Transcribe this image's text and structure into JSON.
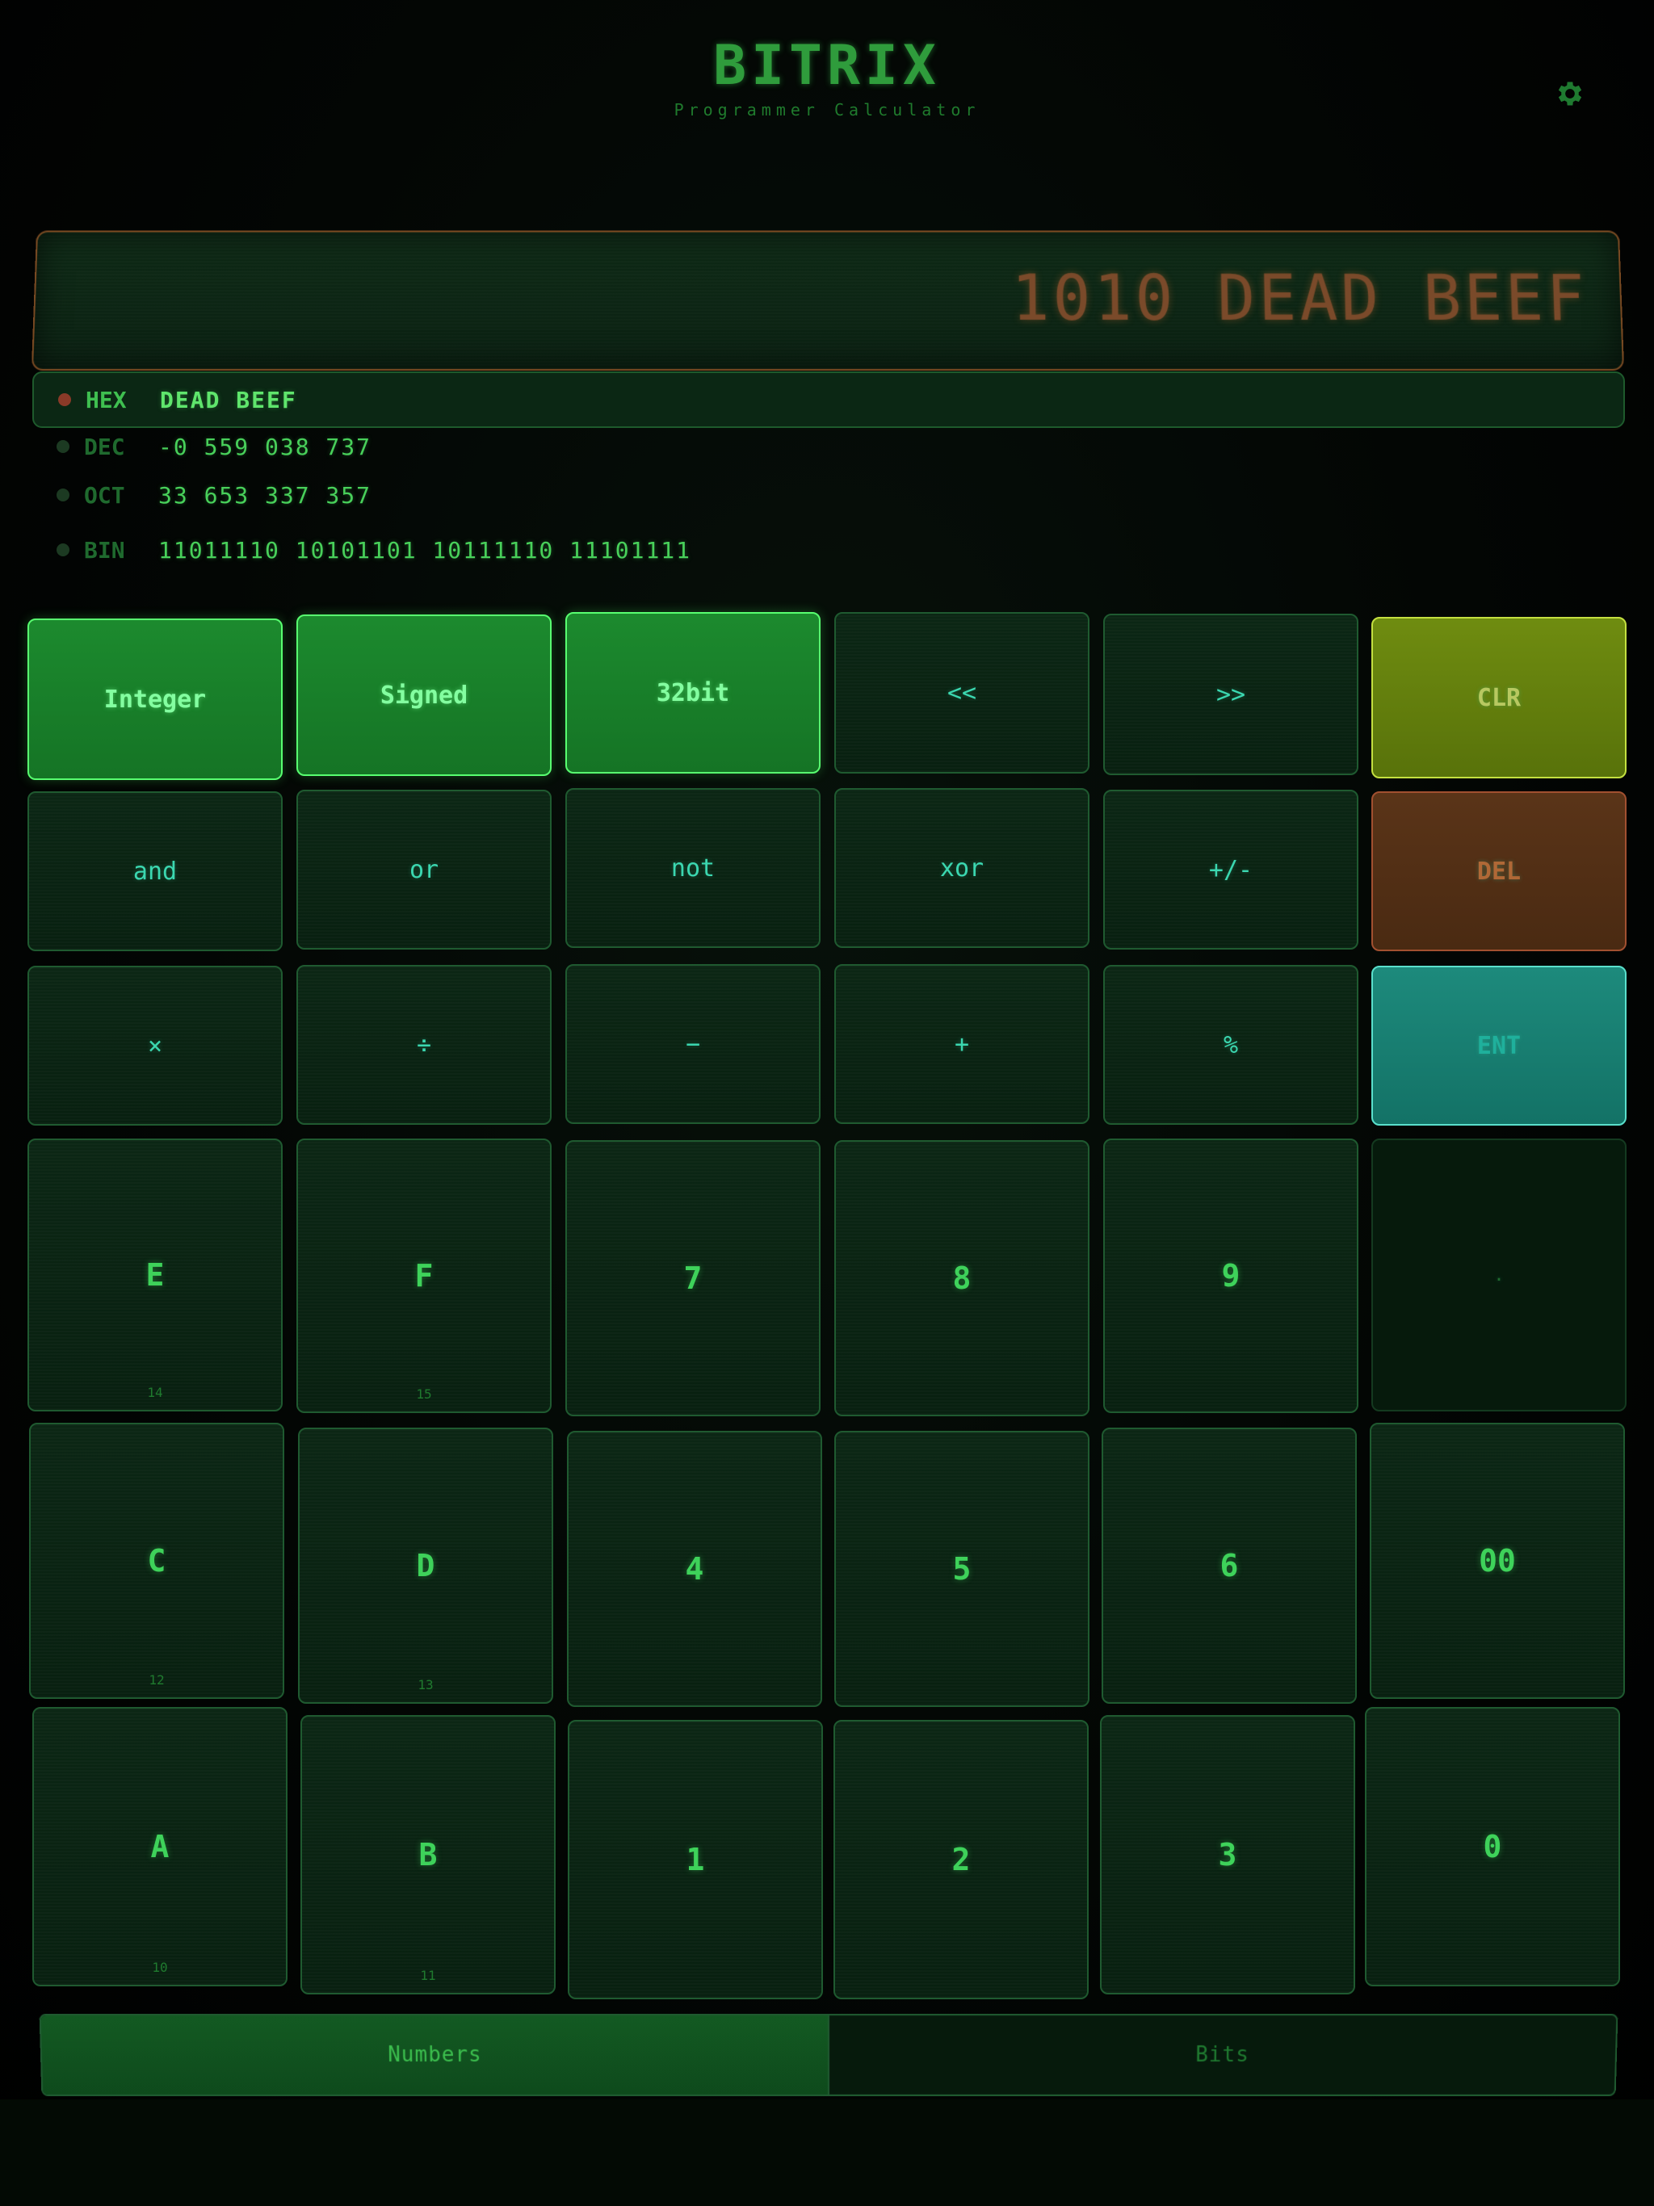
{
  "header": {
    "title": "BITRIX",
    "subtitle": "Programmer Calculator",
    "settings_icon": "gear-icon"
  },
  "display": {
    "main_value": "1010 DEAD BEEF"
  },
  "radix": [
    {
      "name": "HEX",
      "value": "DEAD BEEF",
      "active": true
    },
    {
      "name": "DEC",
      "value": "-0 559 038 737",
      "active": false
    },
    {
      "name": "OCT",
      "value": "33 653 337 357",
      "active": false
    },
    {
      "name": "BIN",
      "value": "11011110 10101101 10111110 11101111",
      "active": false
    }
  ],
  "keys": {
    "row1": [
      "Integer",
      "Signed",
      "32bit",
      "<<",
      ">>",
      "CLR"
    ],
    "row2": [
      "and",
      "or",
      "not",
      "xor",
      "+/-",
      "DEL"
    ],
    "row3": [
      "×",
      "÷",
      "−",
      "+",
      "%",
      "ENT"
    ],
    "row4": [
      {
        "label": "E",
        "sub": "14"
      },
      {
        "label": "F",
        "sub": "15"
      },
      {
        "label": "7"
      },
      {
        "label": "8"
      },
      {
        "label": "9"
      },
      {
        "label": "."
      }
    ],
    "row5": [
      {
        "label": "C",
        "sub": "12"
      },
      {
        "label": "D",
        "sub": "13"
      },
      {
        "label": "4"
      },
      {
        "label": "5"
      },
      {
        "label": "6"
      },
      {
        "label": "00"
      }
    ],
    "row6": [
      {
        "label": "A",
        "sub": "10"
      },
      {
        "label": "B",
        "sub": "11"
      },
      {
        "label": "1"
      },
      {
        "label": "2"
      },
      {
        "label": "3"
      },
      {
        "label": "0"
      }
    ]
  },
  "tabs": [
    {
      "label": "Numbers",
      "active": true
    },
    {
      "label": "Bits",
      "active": false
    }
  ],
  "colors": {
    "accent": "#3ed25a",
    "mode_key": "#1c8a2e",
    "clear_key": "#6f8c10",
    "delete_key": "#5a3418",
    "enter_key": "#1d8a7c",
    "main_display_text": "#7a4a2a"
  }
}
